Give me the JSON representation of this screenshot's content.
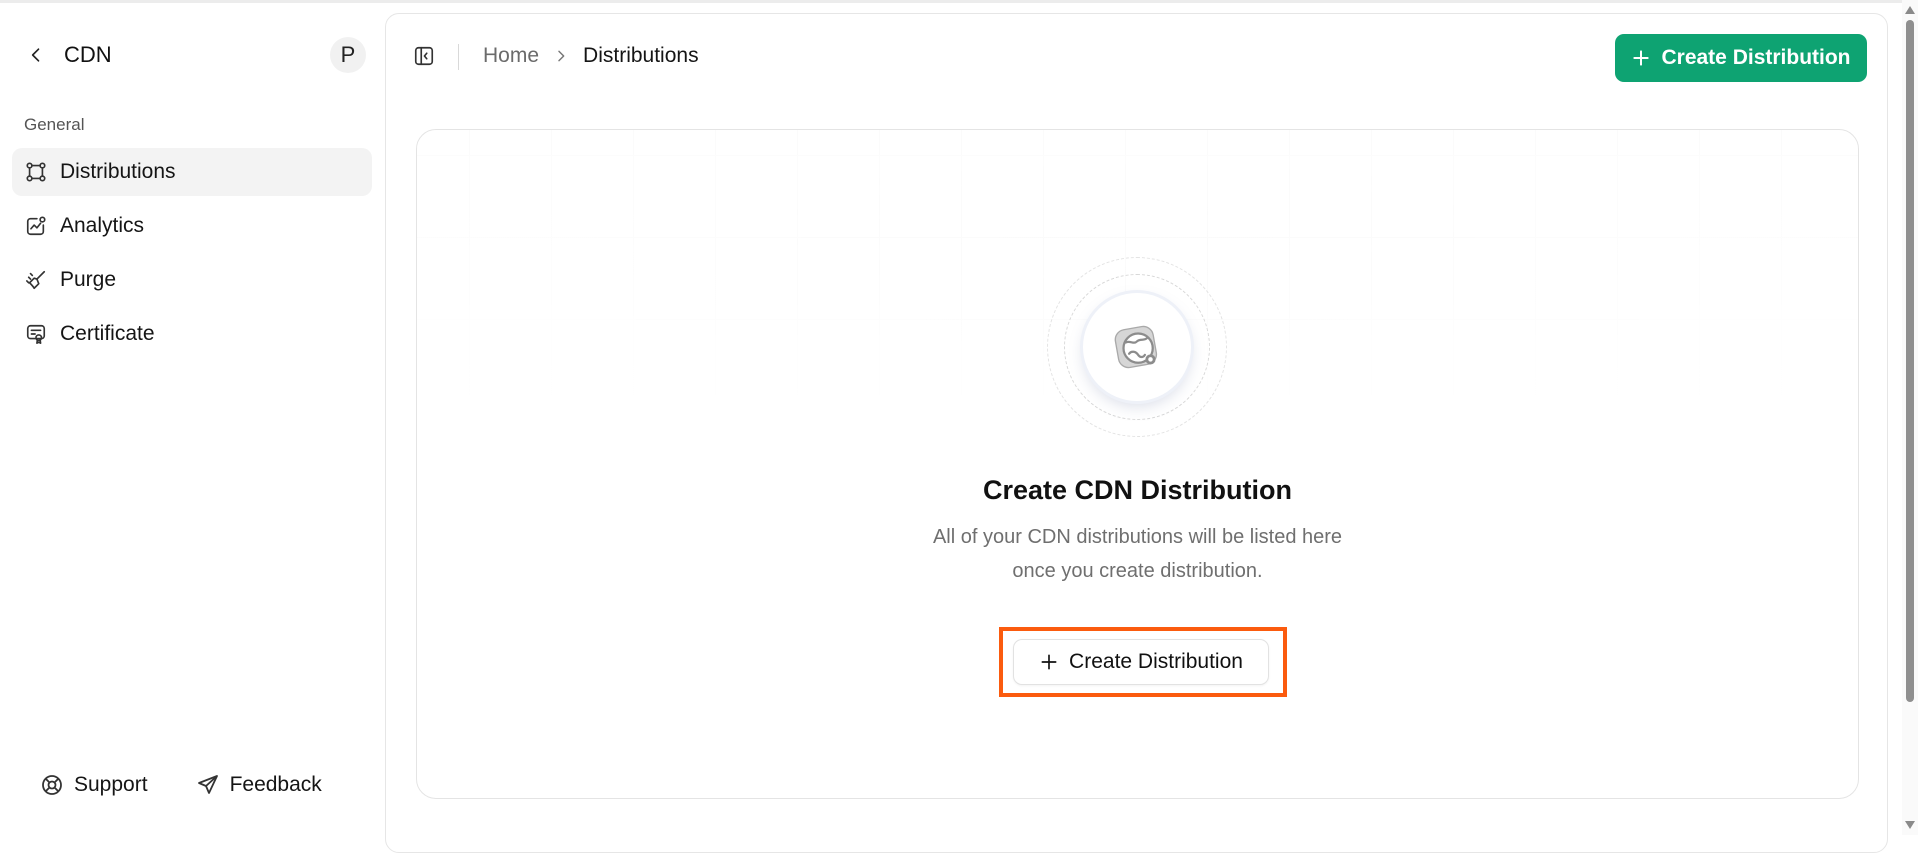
{
  "sidebar": {
    "title": "CDN",
    "avatar_initial": "P",
    "section_label": "General",
    "items": [
      {
        "label": "Distributions",
        "icon": "distributions-icon",
        "active": true
      },
      {
        "label": "Analytics",
        "icon": "analytics-icon",
        "active": false
      },
      {
        "label": "Purge",
        "icon": "purge-icon",
        "active": false
      },
      {
        "label": "Certificate",
        "icon": "certificate-icon",
        "active": false
      }
    ],
    "footer": {
      "support_label": "Support",
      "feedback_label": "Feedback"
    }
  },
  "header": {
    "breadcrumb_home": "Home",
    "breadcrumb_current": "Distributions",
    "primary_button_label": "Create Distribution"
  },
  "empty_state": {
    "title": "Create CDN Distribution",
    "description_line1": "All of your CDN distributions will be listed here",
    "description_line2": "once you create distribution.",
    "button_label": "Create Distribution"
  },
  "colors": {
    "accent": "#0ea372",
    "highlight_frame": "#fb5b0e"
  }
}
